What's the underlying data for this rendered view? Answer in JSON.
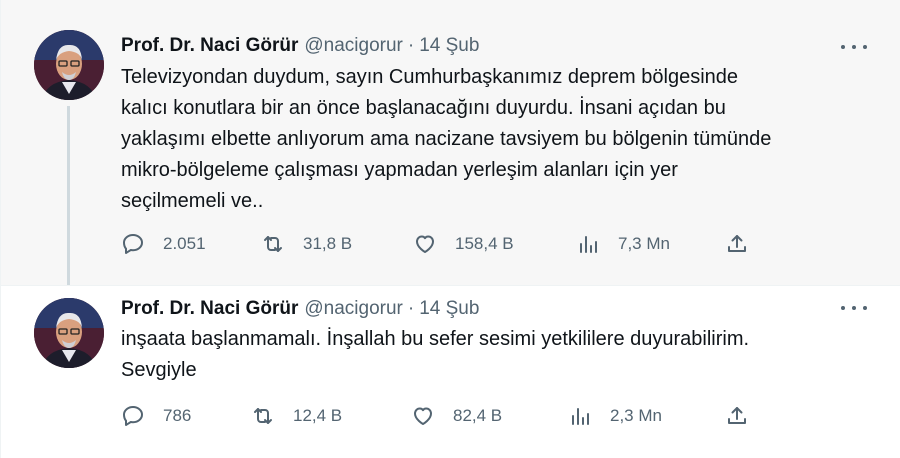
{
  "tweets": [
    {
      "author_name": "Prof. Dr. Naci Görür",
      "handle": "@nacigorur",
      "separator": "·",
      "date": "14 Şub",
      "text_lines": [
        "Televizyondan duydum, sayın Cumhurbaşkanımız deprem bölgesinde",
        "kalıcı konutlara bir an önce başlanacağını duyurdu. İnsani açıdan bu",
        "yaklaşımı elbette anlıyorum ama nacizane tavsiyem bu bölgenin tümünde",
        "mikro-bölgeleme çalışması yapmadan yerleşim alanları için yer",
        "seçilmemeli ve.."
      ],
      "replies": "2.051",
      "retweets": "31,8 B",
      "likes": "158,4 B",
      "views": "7,3 Mn"
    },
    {
      "author_name": "Prof. Dr. Naci Görür",
      "handle": "@nacigorur",
      "separator": "·",
      "date": "14 Şub",
      "text_lines": [
        "inşaata başlanmamalı. İnşallah bu sefer sesimi yetkililere duyurabilirim.",
        "Sevgiyle"
      ],
      "replies": "786",
      "retweets": "12,4 B",
      "likes": "82,4 B",
      "views": "2,3 Mn"
    }
  ],
  "icons": {
    "reply": "reply-icon",
    "retweet": "retweet-icon",
    "like": "like-icon",
    "views": "views-icon",
    "share": "share-icon",
    "more": "more-options-icon"
  },
  "colors": {
    "text": "#0f1419",
    "secondary": "#536471",
    "thread_line": "#cfd9de",
    "highlight_bg": "#f7f7f7"
  }
}
